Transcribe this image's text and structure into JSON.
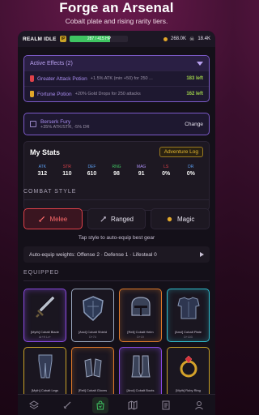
{
  "hero": {
    "title": "Forge an Arsenal",
    "subtitle": "Cobalt plate and rising rarity tiers."
  },
  "topbar": {
    "realm": "REALM IDLE",
    "badge": "IP",
    "hp_text": "287 / 415 HP",
    "hp_fraction": 0.69,
    "gold": "268.0K",
    "kills": "18.4K"
  },
  "effects": {
    "header": "Active Effects (2)",
    "items": [
      {
        "name": "Greater Attack Potion",
        "desc": "+1.5% ATK (min +50) for 250 ...",
        "left": "183 left",
        "color": "#e0414a"
      },
      {
        "name": "Fortune Potion",
        "desc": "+20% Gold Drops for 250 attacks",
        "left": "162 left",
        "color": "#e2a72a"
      }
    ]
  },
  "berserk": {
    "name": "Berserk Fury",
    "desc": "+35% ATK/STR, -5% DR",
    "action": "Change"
  },
  "stats": {
    "title": "My Stats",
    "log_button": "Adventure Log",
    "items": [
      {
        "label": "ATK",
        "value": "312",
        "color": "#5a9ef0"
      },
      {
        "label": "STR",
        "value": "110",
        "color": "#e0414a"
      },
      {
        "label": "DEF",
        "value": "610",
        "color": "#5a9ef0"
      },
      {
        "label": "RNG",
        "value": "98",
        "color": "#3fc462"
      },
      {
        "label": "MAG",
        "value": "91",
        "color": "#a98df0"
      },
      {
        "label": "LS",
        "value": "0%",
        "color": "#e0414a"
      },
      {
        "label": "DR",
        "value": "0%",
        "color": "#5a9ef0"
      }
    ]
  },
  "combat": {
    "section": "COMBAT STYLE",
    "styles": [
      {
        "label": "Melee",
        "icon": "sword-icon",
        "active": true
      },
      {
        "label": "Ranged",
        "icon": "bow-icon",
        "active": false
      },
      {
        "label": "Magic",
        "icon": "magic-icon",
        "active": false
      }
    ],
    "hint": "Tap style to auto-equip best gear"
  },
  "autoequip": {
    "text": "Auto-equip weights: Offense 2 · Defense 1 · Lifesteal 0"
  },
  "equipped": {
    "section": "EQUIPPED",
    "items": [
      {
        "name": "[Myth] Cobalt Blade",
        "sub": "Ar+H Lv+",
        "rarity": "mythic",
        "icon": "sword-icon"
      },
      {
        "name": "[Anci] Cobalt Shield",
        "sub": "D+74",
        "rarity": "ancient",
        "icon": "shield-icon"
      },
      {
        "name": "[Reli] Cobalt Helm",
        "sub": "D+19",
        "rarity": "relic",
        "icon": "helm-icon"
      },
      {
        "name": "[Anci] Cobalt Plate",
        "sub": "D+103",
        "rarity": "ancient-cyan",
        "icon": "chestplate-icon"
      },
      {
        "name": "[Myth] Cobalt Legs",
        "sub": "",
        "rarity": "gold",
        "icon": "legs-icon"
      },
      {
        "name": "[Reli] Cobalt Gloves",
        "sub": "",
        "rarity": "relic",
        "icon": "gloves-icon"
      },
      {
        "name": "[Anci] Cobalt Boots",
        "sub": "",
        "rarity": "mythic",
        "icon": "boots-icon"
      },
      {
        "name": "[Myth] Ruby Ring",
        "sub": "",
        "rarity": "gold",
        "icon": "ring-icon"
      }
    ]
  },
  "nav": [
    {
      "icon": "layers-icon",
      "active": false
    },
    {
      "icon": "sword-icon",
      "active": false
    },
    {
      "icon": "bag-icon",
      "active": true
    },
    {
      "icon": "map-icon",
      "active": false
    },
    {
      "icon": "book-icon",
      "active": false
    },
    {
      "icon": "profile-icon",
      "active": false
    }
  ]
}
